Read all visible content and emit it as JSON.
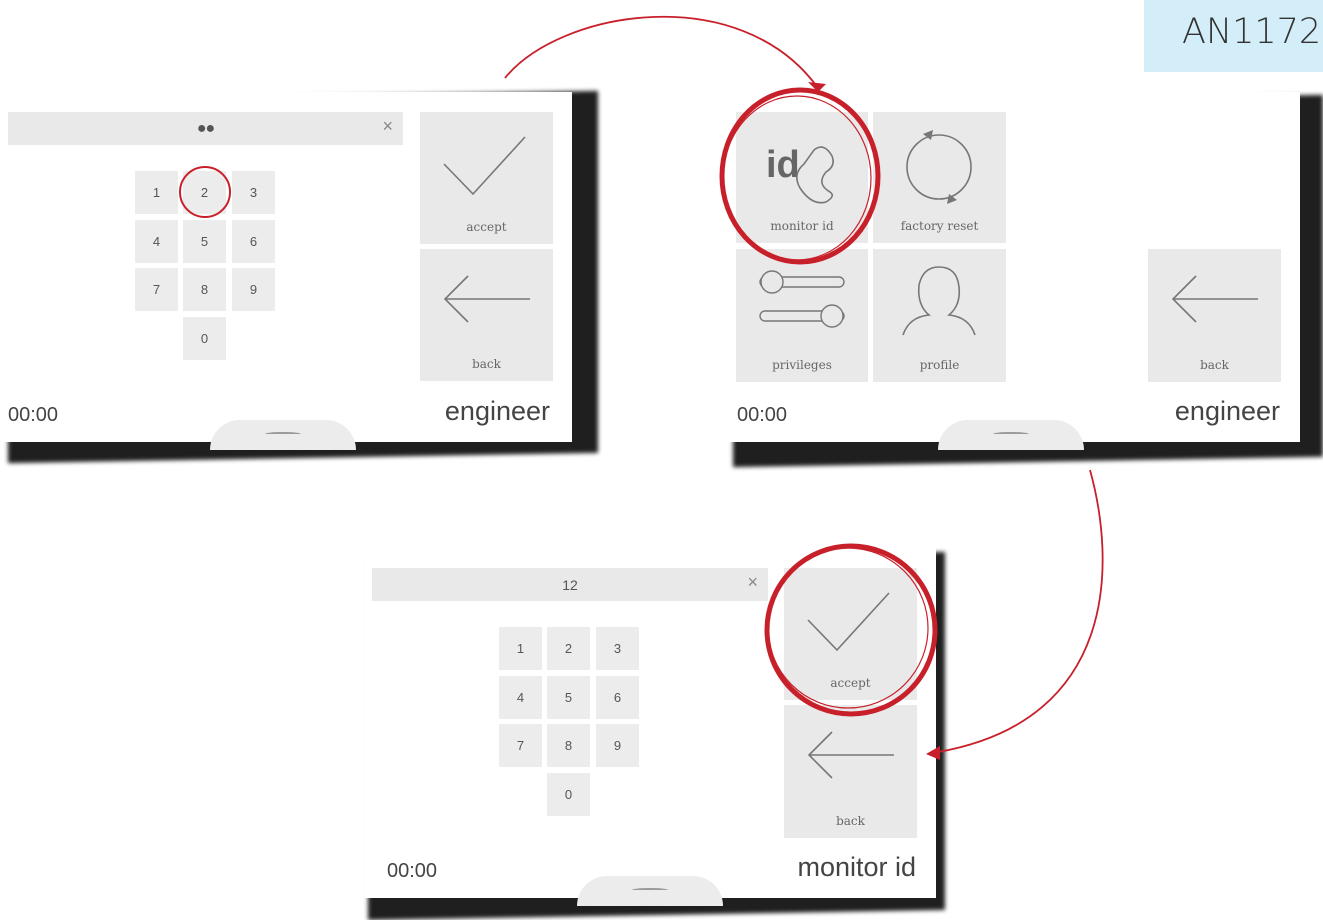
{
  "doc_tag": "AN1172",
  "screens": [
    {
      "entry_value": "●●",
      "clear_glyph": "×",
      "keys": [
        "1",
        "2",
        "3",
        "4",
        "5",
        "6",
        "7",
        "8",
        "9",
        "0"
      ],
      "accept_label": "accept",
      "back_label": "back",
      "time": "00:00",
      "title": "engineer"
    },
    {
      "tiles": [
        {
          "label": "monitor id",
          "icon": "monitor-id-icon",
          "icon_text": "id"
        },
        {
          "label": "factory reset",
          "icon": "factory-reset-icon"
        },
        {
          "label": "privileges",
          "icon": "privileges-sliders-icon"
        },
        {
          "label": "profile",
          "icon": "profile-icon"
        }
      ],
      "back_label": "back",
      "time": "00:00",
      "title": "engineer"
    },
    {
      "entry_value": "12",
      "clear_glyph": "×",
      "keys": [
        "1",
        "2",
        "3",
        "4",
        "5",
        "6",
        "7",
        "8",
        "9",
        "0"
      ],
      "accept_label": "accept",
      "back_label": "back",
      "time": "00:00",
      "title": "monitor id"
    }
  ],
  "annotation_color": "#c8202a"
}
